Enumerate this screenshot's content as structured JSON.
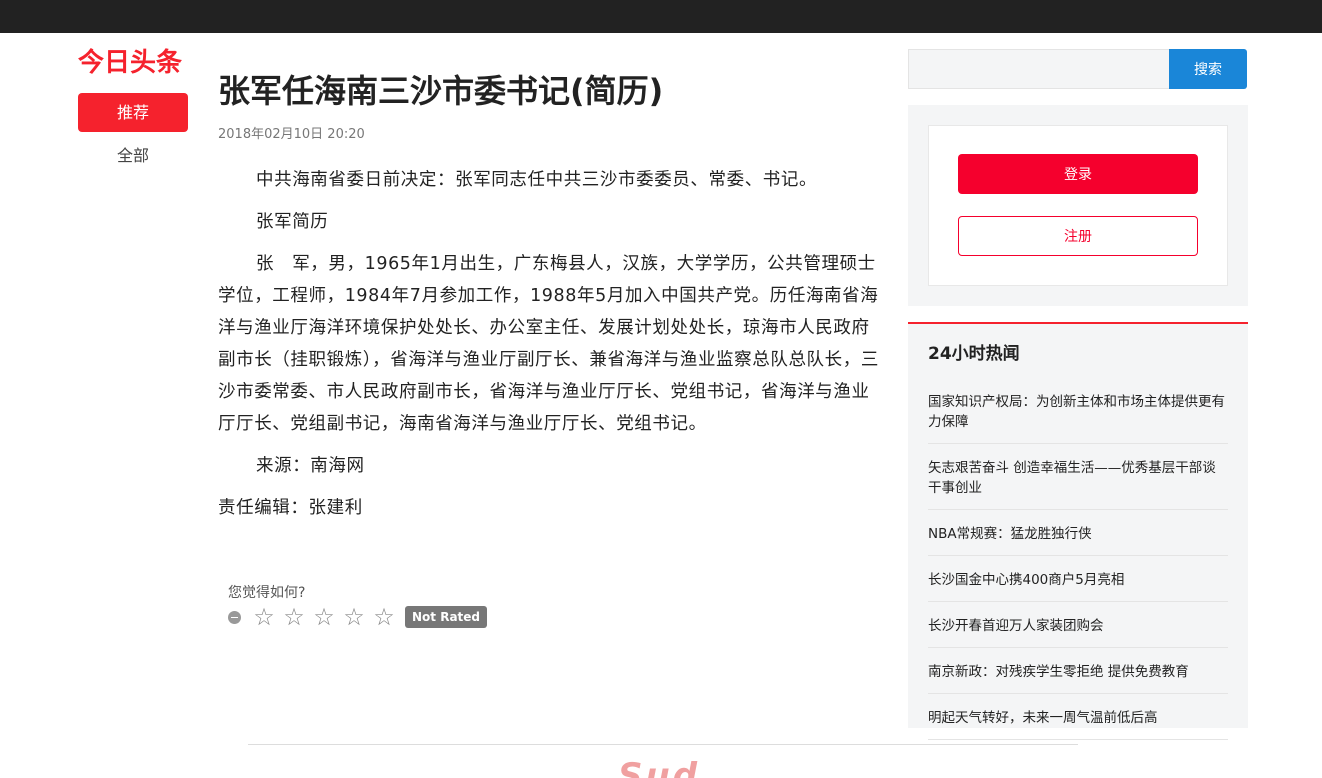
{
  "logo": "今日头条",
  "nav": {
    "active": "推荐",
    "all": "全部"
  },
  "article": {
    "title": "张军任海南三沙市委书记(简历)",
    "time": "2018年02月10日 20:20",
    "paragraphs": [
      "中共海南省委日前决定：张军同志任中共三沙市委委员、常委、书记。",
      "张军简历",
      "张　军，男，1965年1月出生，广东梅县人，汉族，大学学历，公共管理硕士学位，工程师，1984年7月参加工作，1988年5月加入中国共产党。历任海南省海洋与渔业厅海洋环境保护处处长、办公室主任、发展计划处处长，琼海市人民政府副市长（挂职锻炼），省海洋与渔业厅副厅长、兼省海洋与渔业监察总队总队长，三沙市委常委、市人民政府副市长，省海洋与渔业厅厅长、党组书记，省海洋与渔业厅厅长、党组副书记，海南省海洋与渔业厅厅长、党组书记。",
      "来源：南海网"
    ],
    "editor": "责任编辑：张建利"
  },
  "rating": {
    "question": "您觉得如何?",
    "stars": [
      "☆",
      "☆",
      "☆",
      "☆",
      "☆"
    ],
    "badge": "Not Rated"
  },
  "search": {
    "placeholder": "",
    "button": "搜索"
  },
  "auth": {
    "login": "登录",
    "register": "注册"
  },
  "hot": {
    "title": "24小时热闻",
    "items": [
      "国家知识产权局：为创新主体和市场主体提供更有力保障",
      "矢志艰苦奋斗 创造幸福生活——优秀基层干部谈干事创业",
      "NBA常规赛：猛龙胜独行侠",
      "长沙国金中心携400商户5月亮相",
      "长沙开春首迎万人家装团购会",
      "南京新政：对残疾学生零拒绝 提供免费教育",
      "明起天气转好，未来一周气温前低后高"
    ]
  },
  "footer": {
    "logo": "Sud"
  },
  "colors": {
    "brand": "#f5222d",
    "search": "#1a86d8",
    "topbar": "#222222"
  }
}
